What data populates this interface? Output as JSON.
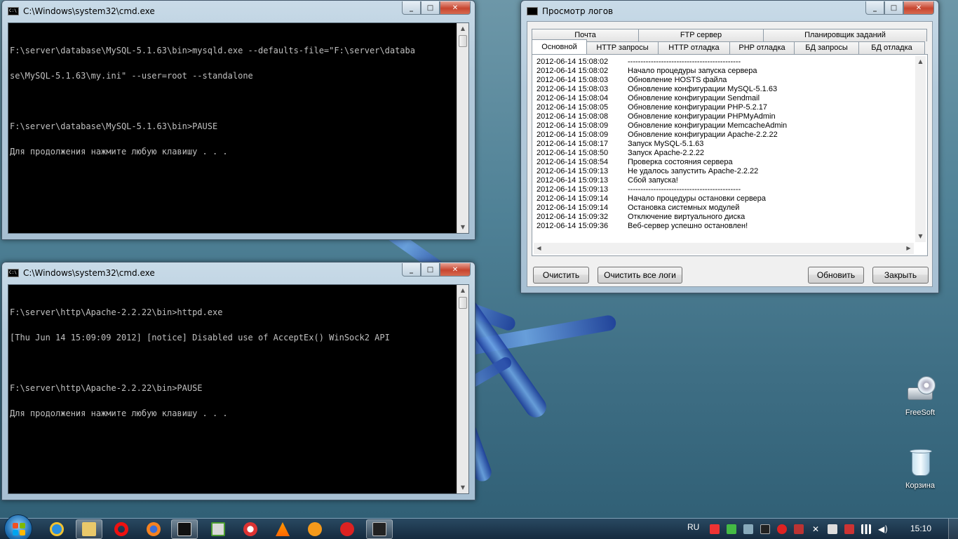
{
  "colors": {
    "console_bg": "#000000",
    "console_text": "#c0c0c0",
    "taskbar": "#1e3a52",
    "close_button": "#c7452f"
  },
  "cmd1": {
    "title": "C:\\Windows\\system32\\cmd.exe",
    "lines": [
      "F:\\server\\database\\MySQL-5.1.63\\bin>mysqld.exe --defaults-file=\"F:\\server\\databa",
      "se\\MySQL-5.1.63\\my.ini\" --user=root --standalone",
      "",
      "F:\\server\\database\\MySQL-5.1.63\\bin>PAUSE",
      "Для продолжения нажмите любую клавишу . . ."
    ]
  },
  "cmd2": {
    "title": "C:\\Windows\\system32\\cmd.exe",
    "lines": [
      "F:\\server\\http\\Apache-2.2.22\\bin>httpd.exe",
      "[Thu Jun 14 15:09:09 2012] [notice] Disabled use of AcceptEx() WinSock2 API",
      "",
      "F:\\server\\http\\Apache-2.2.22\\bin>PAUSE",
      "Для продолжения нажмите любую клавишу . . ."
    ]
  },
  "logviewer": {
    "title": "Просмотр логов",
    "tabs_top": [
      "Почта",
      "FTP сервер",
      "Планировщик заданий"
    ],
    "tabs_bottom": [
      "Основной",
      "HTTP запросы",
      "HTTP отладка",
      "PHP отладка",
      "БД запросы",
      "БД отладка"
    ],
    "active_tab": "Основной",
    "log": [
      {
        "ts": "2012-06-14 15:08:02",
        "msg": "--------------------------------------------"
      },
      {
        "ts": "2012-06-14 15:08:02",
        "msg": "Начало процедуры запуска сервера"
      },
      {
        "ts": "2012-06-14 15:08:03",
        "msg": "Обновление HOSTS файла"
      },
      {
        "ts": "2012-06-14 15:08:03",
        "msg": "Обновление конфигурации MySQL-5.1.63"
      },
      {
        "ts": "2012-06-14 15:08:04",
        "msg": "Обновление конфигурации Sendmail"
      },
      {
        "ts": "2012-06-14 15:08:05",
        "msg": "Обновление конфигурации PHP-5.2.17"
      },
      {
        "ts": "2012-06-14 15:08:08",
        "msg": "Обновление конфигурации PHPMyAdmin"
      },
      {
        "ts": "2012-06-14 15:08:09",
        "msg": "Обновление конфигурации MemcacheAdmin"
      },
      {
        "ts": "2012-06-14 15:08:09",
        "msg": "Обновление конфигурации Apache-2.2.22"
      },
      {
        "ts": "2012-06-14 15:08:17",
        "msg": "Запуск MySQL-5.1.63"
      },
      {
        "ts": "2012-06-14 15:08:50",
        "msg": "Запуск Apache-2.2.22"
      },
      {
        "ts": "2012-06-14 15:08:54",
        "msg": "Проверка состояния сервера"
      },
      {
        "ts": "2012-06-14 15:09:13",
        "msg": "Не удалось запустить Apache-2.2.22"
      },
      {
        "ts": "2012-06-14 15:09:13",
        "msg": "Сбой запуска!"
      },
      {
        "ts": "2012-06-14 15:09:13",
        "msg": "--------------------------------------------"
      },
      {
        "ts": "2012-06-14 15:09:14",
        "msg": "Начало процедуры остановки сервера"
      },
      {
        "ts": "2012-06-14 15:09:14",
        "msg": "Остановка системных модулей"
      },
      {
        "ts": "2012-06-14 15:09:32",
        "msg": "Отключение виртуального диска"
      },
      {
        "ts": "2012-06-14 15:09:36",
        "msg": "Веб-сервер успешно остановлен!"
      }
    ],
    "buttons": {
      "clear": "Очистить",
      "clear_all": "Очистить все логи",
      "refresh": "Обновить",
      "close": "Закрыть"
    }
  },
  "desktop": {
    "icons": [
      {
        "label": "FreeSoft",
        "icon": "drive-icon"
      },
      {
        "label": "Корзина",
        "icon": "recycle-bin-icon"
      }
    ]
  },
  "taskbar": {
    "lang": "RU",
    "clock": "15:10",
    "pinned": [
      "ie-icon",
      "explorer-icon",
      "opera-icon",
      "firefox-icon",
      "cmd-icon",
      "app-icon",
      "chrome-like-icon",
      "vlc-icon",
      "orange-app-icon",
      "red-app-icon",
      "console-icon"
    ]
  }
}
